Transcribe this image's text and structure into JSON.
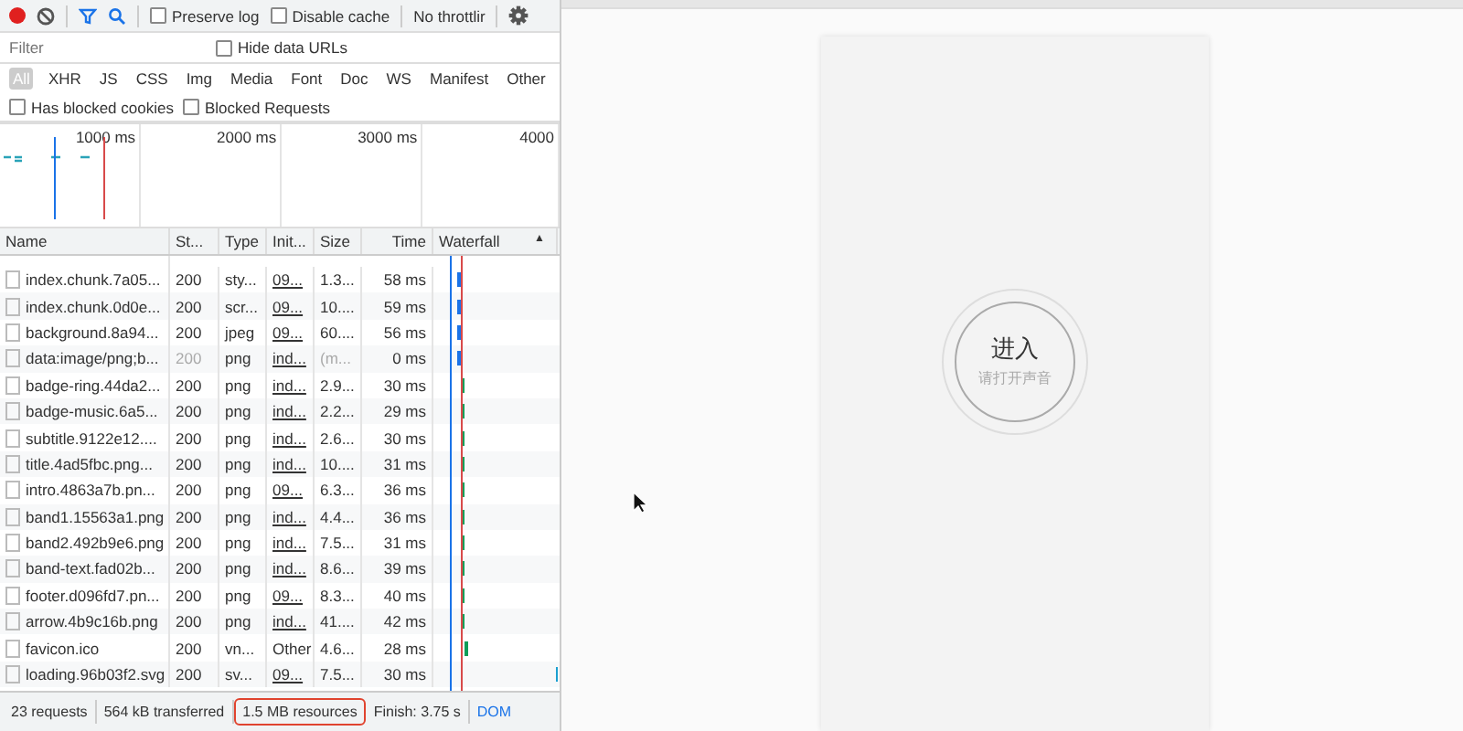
{
  "toolbar": {
    "recording": true,
    "preserve_log": {
      "label": "Preserve log",
      "checked": false
    },
    "disable_cache": {
      "label": "Disable cache",
      "checked": false
    },
    "throttling": "No throttlir"
  },
  "filter": {
    "placeholder": "Filter",
    "hide_data_urls": {
      "label": "Hide data URLs",
      "checked": false
    }
  },
  "type_filters": [
    {
      "label": "All",
      "selected": true
    },
    {
      "label": "XHR",
      "selected": false
    },
    {
      "label": "JS",
      "selected": false
    },
    {
      "label": "CSS",
      "selected": false
    },
    {
      "label": "Img",
      "selected": false
    },
    {
      "label": "Media",
      "selected": false
    },
    {
      "label": "Font",
      "selected": false
    },
    {
      "label": "Doc",
      "selected": false
    },
    {
      "label": "WS",
      "selected": false
    },
    {
      "label": "Manifest",
      "selected": false
    },
    {
      "label": "Other",
      "selected": false
    }
  ],
  "blocked_filters": [
    {
      "label": "Has blocked cookies",
      "checked": false
    },
    {
      "label": "Blocked Requests",
      "checked": false
    }
  ],
  "overview": {
    "ticks": [
      "1000 ms",
      "2000 ms",
      "3000 ms",
      "4000"
    ]
  },
  "table": {
    "columns": [
      "Name",
      "St...",
      "Type",
      "Init...",
      "Size",
      "Time",
      "Waterfall"
    ],
    "sort_icon": "▲",
    "rows": [
      {
        "name": "index.chunk.7a05...",
        "status": "200",
        "type": "sty...",
        "initiator": "09...",
        "size": "1.3...",
        "time": "58 ms",
        "dim": false,
        "color": "#1a73e8"
      },
      {
        "name": "index.chunk.0d0e...",
        "status": "200",
        "type": "scr...",
        "initiator": "09...",
        "size": "10....",
        "time": "59 ms",
        "dim": false,
        "color": "#1a73e8"
      },
      {
        "name": "background.8a94...",
        "status": "200",
        "type": "jpeg",
        "initiator": "09...",
        "size": "60....",
        "time": "56 ms",
        "dim": false,
        "color": "#1a73e8"
      },
      {
        "name": "data:image/png;b...",
        "status": "200",
        "type": "png",
        "initiator": "ind...",
        "size": "(m...",
        "time": "0 ms",
        "dim": true,
        "color": "#1a73e8"
      },
      {
        "name": "badge-ring.44da2...",
        "status": "200",
        "type": "png",
        "initiator": "ind...",
        "size": "2.9...",
        "time": "30 ms",
        "dim": false,
        "color": "#0f9d58"
      },
      {
        "name": "badge-music.6a5...",
        "status": "200",
        "type": "png",
        "initiator": "ind...",
        "size": "2.2...",
        "time": "29 ms",
        "dim": false,
        "color": "#0f9d58"
      },
      {
        "name": "subtitle.9122e12....",
        "status": "200",
        "type": "png",
        "initiator": "ind...",
        "size": "2.6...",
        "time": "30 ms",
        "dim": false,
        "color": "#0f9d58"
      },
      {
        "name": "title.4ad5fbc.png...",
        "status": "200",
        "type": "png",
        "initiator": "ind...",
        "size": "10....",
        "time": "31 ms",
        "dim": false,
        "color": "#0f9d58"
      },
      {
        "name": "intro.4863a7b.pn...",
        "status": "200",
        "type": "png",
        "initiator": "09...",
        "size": "6.3...",
        "time": "36 ms",
        "dim": false,
        "color": "#0f9d58"
      },
      {
        "name": "band1.15563a1.png",
        "status": "200",
        "type": "png",
        "initiator": "ind...",
        "size": "4.4...",
        "time": "36 ms",
        "dim": false,
        "color": "#0f9d58"
      },
      {
        "name": "band2.492b9e6.png",
        "status": "200",
        "type": "png",
        "initiator": "ind...",
        "size": "7.5...",
        "time": "31 ms",
        "dim": false,
        "color": "#0f9d58"
      },
      {
        "name": "band-text.fad02b...",
        "status": "200",
        "type": "png",
        "initiator": "ind...",
        "size": "8.6...",
        "time": "39 ms",
        "dim": false,
        "color": "#0f9d58"
      },
      {
        "name": "footer.d096fd7.pn...",
        "status": "200",
        "type": "png",
        "initiator": "09...",
        "size": "8.3...",
        "time": "40 ms",
        "dim": false,
        "color": "#0f9d58"
      },
      {
        "name": "arrow.4b9c16b.png",
        "status": "200",
        "type": "png",
        "initiator": "ind...",
        "size": "41....",
        "time": "42 ms",
        "dim": false,
        "color": "#0f9d58"
      },
      {
        "name": "favicon.ico",
        "status": "200",
        "type": "vn...",
        "initiator": "Other",
        "size": "4.6...",
        "time": "28 ms",
        "dim": false,
        "color": "#0f9d58"
      },
      {
        "name": "loading.96b03f2.svg",
        "status": "200",
        "type": "sv...",
        "initiator": "09...",
        "size": "7.5...",
        "time": "30 ms",
        "dim": false,
        "color": "#1a9fd0"
      }
    ]
  },
  "status_bar": [
    {
      "text": "23 requests",
      "highlighted": false
    },
    {
      "text": "564 kB transferred",
      "highlighted": false
    },
    {
      "text": "1.5 MB resources",
      "highlighted": true
    },
    {
      "text": "Finish: 3.75 s",
      "highlighted": false
    },
    {
      "text": "DOM",
      "highlighted": false
    }
  ],
  "preview": {
    "button_title": "进入",
    "button_subtitle": "请打开声音"
  }
}
